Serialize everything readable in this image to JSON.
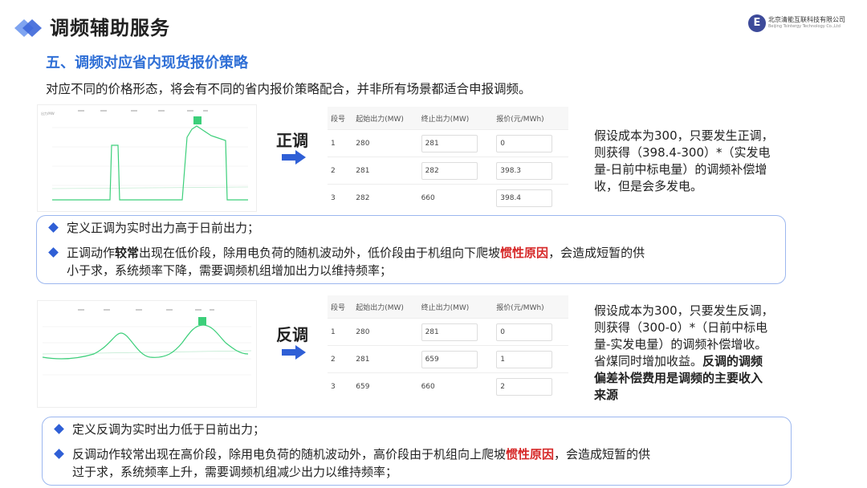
{
  "header": {
    "title": "调频辅助服务",
    "company_cn": "北京清能互联科技有限公司",
    "company_en": "Beijing Tsintergy Technology Co.,Ltd"
  },
  "section_title": "五、调频对应省内现货报价策略",
  "intro": "对应不同的价格形态，将会有不同的省内报价策略配合，并非所有场景都适合申报调频。",
  "upper": {
    "direction_label": "正调",
    "table": {
      "headers": [
        "段号",
        "起始出力(MW)",
        "终止出力(MW)",
        "报价(元/MWh)"
      ],
      "rows": [
        [
          "1",
          "280",
          "281",
          "0"
        ],
        [
          "2",
          "281",
          "282",
          "398.3"
        ],
        [
          "3",
          "282",
          "660",
          "398.4"
        ]
      ]
    },
    "note_line1": "假设成本为300，只要发生正调，",
    "note_line2": "则获得（398.4-300）*（实发电",
    "note_line3": "量-日前中标电量）的调频补偿增",
    "note_line4": "收，但是会多发电。",
    "bullet1": "定义正调为实时出力高于日前出力；",
    "bullet2_a": "正调动作",
    "bullet2_b": "较常",
    "bullet2_c": "出现在低价段，除用电负荷的随机波动外，低价段由于机组向下爬坡",
    "bullet2_red": "惯性原因",
    "bullet2_d": "，会造成短暂的供",
    "bullet2_line2": "小于求，系统频率下降，需要调频机组增加出力以维持频率；"
  },
  "lower": {
    "direction_label": "反调",
    "table": {
      "headers": [
        "段号",
        "起始出力(MW)",
        "终止出力(MW)",
        "报价(元/MWh)"
      ],
      "rows": [
        [
          "1",
          "280",
          "281",
          "0"
        ],
        [
          "2",
          "281",
          "659",
          "1"
        ],
        [
          "3",
          "659",
          "660",
          "2"
        ]
      ]
    },
    "note_line1": "假设成本为300，只要发生反调，",
    "note_line2": "则获得（300-0）*（日前中标电",
    "note_line3": "量-实发电量）的调频补偿增收。",
    "note_line4": "省煤同时增加收益。",
    "note_bold1": "反调的调频",
    "note_bold2": "偏差补偿费用是调频的主要收入",
    "note_bold3": "来源",
    "bullet1": "定义反调为实时出力低于日前出力；",
    "bullet2_a": "反调动作较常出现在高价段，除用电负荷的随机波动外，高价段由于机组向上爬坡",
    "bullet2_red": "惯性原因",
    "bullet2_d": "，会造成短暂的供",
    "bullet2_line2": "过于求，系统频率上升，需要调频机组减少出力以维持频率；"
  },
  "colors": {
    "accent": "#2f6fd6",
    "chart_line": "#3ccf7a",
    "highlight": "#d62828"
  }
}
